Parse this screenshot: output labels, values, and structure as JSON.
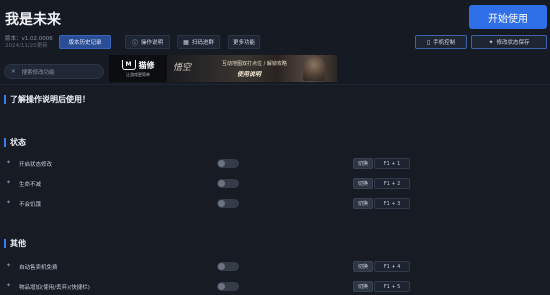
{
  "app": {
    "title": "我是未来",
    "version": "版本：v1.02.0006",
    "build_date": "2024/11/20更新"
  },
  "header": {
    "start_label": "开始使用",
    "toolbar": [
      {
        "label": "版本历史记录",
        "icon": "",
        "style": "blue"
      },
      {
        "label": "操作说明",
        "icon": "info-icon",
        "style": "dark"
      },
      {
        "label": "扫码进群",
        "icon": "qr-icon",
        "style": "dark"
      },
      {
        "label": "更多功能",
        "icon": "",
        "style": "dark"
      }
    ],
    "mobile_label": "手机控制",
    "save_label": "修改状态保存"
  },
  "search": {
    "placeholder": "搜索修改功能"
  },
  "banner": {
    "brand": "猫修",
    "slogan": "让游戏更简单",
    "calligraphy": "悟空",
    "line1": "互动地图双打点位 / 解锁攻略",
    "line2": "使用说明"
  },
  "notice": "了解操作说明后使用！",
  "sections": [
    {
      "title": "状态",
      "rows": [
        {
          "label": "开启状态修改",
          "toggle": "切换",
          "hotkey": "F1 + 1"
        },
        {
          "label": "生命不减",
          "toggle": "切换",
          "hotkey": "F1 + 2"
        },
        {
          "label": "不会饥饿",
          "toggle": "切换",
          "hotkey": "F1 + 3"
        }
      ]
    },
    {
      "title": "其他",
      "rows": [
        {
          "label": "自动售卖机免费",
          "toggle": "切换",
          "hotkey": "F1 + 4"
        },
        {
          "label": "物品增加(使用/丢弃)(快捷栏)",
          "toggle": "切换",
          "hotkey": "F1 + 5"
        }
      ]
    }
  ],
  "colors": {
    "accent": "#2f6fe8",
    "background": "#151a23",
    "section_bar": "#3b7cf5"
  }
}
